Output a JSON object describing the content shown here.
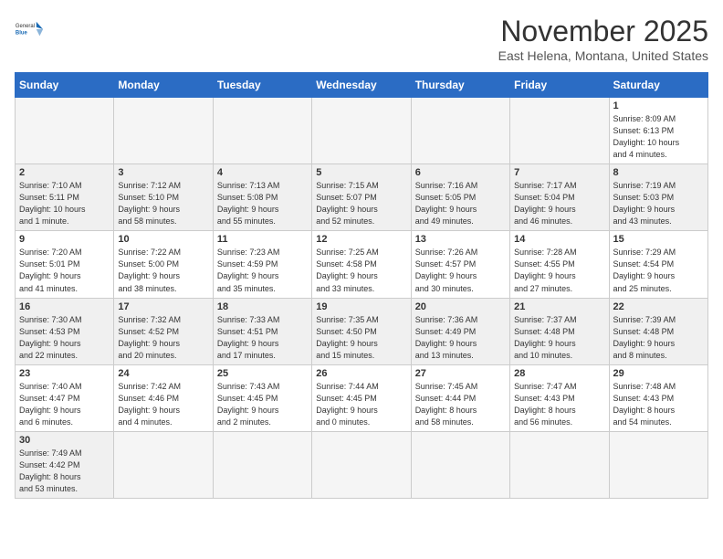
{
  "header": {
    "logo_general": "General",
    "logo_blue": "Blue",
    "month_title": "November 2025",
    "location": "East Helena, Montana, United States"
  },
  "weekdays": [
    "Sunday",
    "Monday",
    "Tuesday",
    "Wednesday",
    "Thursday",
    "Friday",
    "Saturday"
  ],
  "weeks": [
    [
      {
        "day": "",
        "info": ""
      },
      {
        "day": "",
        "info": ""
      },
      {
        "day": "",
        "info": ""
      },
      {
        "day": "",
        "info": ""
      },
      {
        "day": "",
        "info": ""
      },
      {
        "day": "",
        "info": ""
      },
      {
        "day": "1",
        "info": "Sunrise: 8:09 AM\nSunset: 6:13 PM\nDaylight: 10 hours\nand 4 minutes."
      }
    ],
    [
      {
        "day": "2",
        "info": "Sunrise: 7:10 AM\nSunset: 5:11 PM\nDaylight: 10 hours\nand 1 minute."
      },
      {
        "day": "3",
        "info": "Sunrise: 7:12 AM\nSunset: 5:10 PM\nDaylight: 9 hours\nand 58 minutes."
      },
      {
        "day": "4",
        "info": "Sunrise: 7:13 AM\nSunset: 5:08 PM\nDaylight: 9 hours\nand 55 minutes."
      },
      {
        "day": "5",
        "info": "Sunrise: 7:15 AM\nSunset: 5:07 PM\nDaylight: 9 hours\nand 52 minutes."
      },
      {
        "day": "6",
        "info": "Sunrise: 7:16 AM\nSunset: 5:05 PM\nDaylight: 9 hours\nand 49 minutes."
      },
      {
        "day": "7",
        "info": "Sunrise: 7:17 AM\nSunset: 5:04 PM\nDaylight: 9 hours\nand 46 minutes."
      },
      {
        "day": "8",
        "info": "Sunrise: 7:19 AM\nSunset: 5:03 PM\nDaylight: 9 hours\nand 43 minutes."
      }
    ],
    [
      {
        "day": "9",
        "info": "Sunrise: 7:20 AM\nSunset: 5:01 PM\nDaylight: 9 hours\nand 41 minutes."
      },
      {
        "day": "10",
        "info": "Sunrise: 7:22 AM\nSunset: 5:00 PM\nDaylight: 9 hours\nand 38 minutes."
      },
      {
        "day": "11",
        "info": "Sunrise: 7:23 AM\nSunset: 4:59 PM\nDaylight: 9 hours\nand 35 minutes."
      },
      {
        "day": "12",
        "info": "Sunrise: 7:25 AM\nSunset: 4:58 PM\nDaylight: 9 hours\nand 33 minutes."
      },
      {
        "day": "13",
        "info": "Sunrise: 7:26 AM\nSunset: 4:57 PM\nDaylight: 9 hours\nand 30 minutes."
      },
      {
        "day": "14",
        "info": "Sunrise: 7:28 AM\nSunset: 4:55 PM\nDaylight: 9 hours\nand 27 minutes."
      },
      {
        "day": "15",
        "info": "Sunrise: 7:29 AM\nSunset: 4:54 PM\nDaylight: 9 hours\nand 25 minutes."
      }
    ],
    [
      {
        "day": "16",
        "info": "Sunrise: 7:30 AM\nSunset: 4:53 PM\nDaylight: 9 hours\nand 22 minutes."
      },
      {
        "day": "17",
        "info": "Sunrise: 7:32 AM\nSunset: 4:52 PM\nDaylight: 9 hours\nand 20 minutes."
      },
      {
        "day": "18",
        "info": "Sunrise: 7:33 AM\nSunset: 4:51 PM\nDaylight: 9 hours\nand 17 minutes."
      },
      {
        "day": "19",
        "info": "Sunrise: 7:35 AM\nSunset: 4:50 PM\nDaylight: 9 hours\nand 15 minutes."
      },
      {
        "day": "20",
        "info": "Sunrise: 7:36 AM\nSunset: 4:49 PM\nDaylight: 9 hours\nand 13 minutes."
      },
      {
        "day": "21",
        "info": "Sunrise: 7:37 AM\nSunset: 4:48 PM\nDaylight: 9 hours\nand 10 minutes."
      },
      {
        "day": "22",
        "info": "Sunrise: 7:39 AM\nSunset: 4:48 PM\nDaylight: 9 hours\nand 8 minutes."
      }
    ],
    [
      {
        "day": "23",
        "info": "Sunrise: 7:40 AM\nSunset: 4:47 PM\nDaylight: 9 hours\nand 6 minutes."
      },
      {
        "day": "24",
        "info": "Sunrise: 7:42 AM\nSunset: 4:46 PM\nDaylight: 9 hours\nand 4 minutes."
      },
      {
        "day": "25",
        "info": "Sunrise: 7:43 AM\nSunset: 4:45 PM\nDaylight: 9 hours\nand 2 minutes."
      },
      {
        "day": "26",
        "info": "Sunrise: 7:44 AM\nSunset: 4:45 PM\nDaylight: 9 hours\nand 0 minutes."
      },
      {
        "day": "27",
        "info": "Sunrise: 7:45 AM\nSunset: 4:44 PM\nDaylight: 8 hours\nand 58 minutes."
      },
      {
        "day": "28",
        "info": "Sunrise: 7:47 AM\nSunset: 4:43 PM\nDaylight: 8 hours\nand 56 minutes."
      },
      {
        "day": "29",
        "info": "Sunrise: 7:48 AM\nSunset: 4:43 PM\nDaylight: 8 hours\nand 54 minutes."
      }
    ],
    [
      {
        "day": "30",
        "info": "Sunrise: 7:49 AM\nSunset: 4:42 PM\nDaylight: 8 hours\nand 53 minutes."
      },
      {
        "day": "",
        "info": ""
      },
      {
        "day": "",
        "info": ""
      },
      {
        "day": "",
        "info": ""
      },
      {
        "day": "",
        "info": ""
      },
      {
        "day": "",
        "info": ""
      },
      {
        "day": "",
        "info": ""
      }
    ]
  ]
}
